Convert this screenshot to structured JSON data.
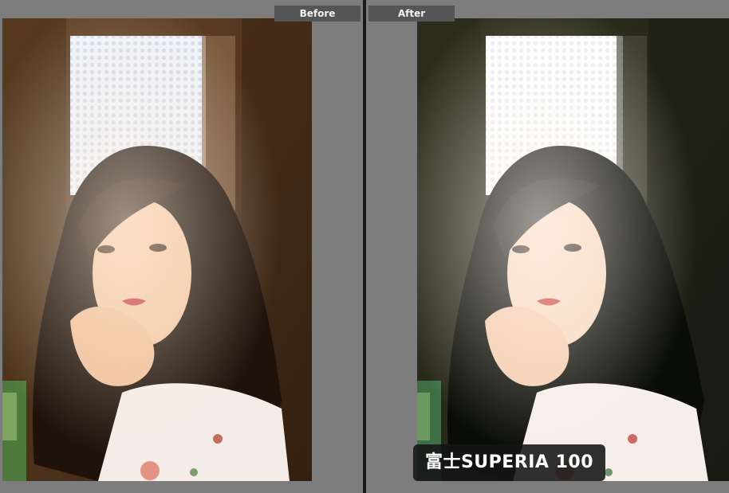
{
  "comparison": {
    "before_label": "Before",
    "after_label": "After",
    "preset_label": "富士SUPERIA 100"
  },
  "photo_before": {
    "description_icon": "portrait-photo-icon",
    "tone": "warm",
    "colors": {
      "wall": "#5a3d24",
      "wall_dark": "#3a2514",
      "window": "#f4f6fb",
      "hair": "#1e120a",
      "skin": "#f3c7a3",
      "lips": "#c2343a",
      "blouse": "#f4ede7",
      "foliage": "#4f7a3e"
    }
  },
  "photo_after": {
    "description_icon": "portrait-photo-icon",
    "tone": "cool-teal",
    "colors": {
      "wall": "#2c2c1e",
      "wall_dark": "#171a12",
      "window": "#ffffff",
      "hair": "#0a0c08",
      "skin": "#f8d8bf",
      "lips": "#c63c36",
      "blouse": "#f7eee9",
      "foliage": "#3f6e44"
    }
  }
}
